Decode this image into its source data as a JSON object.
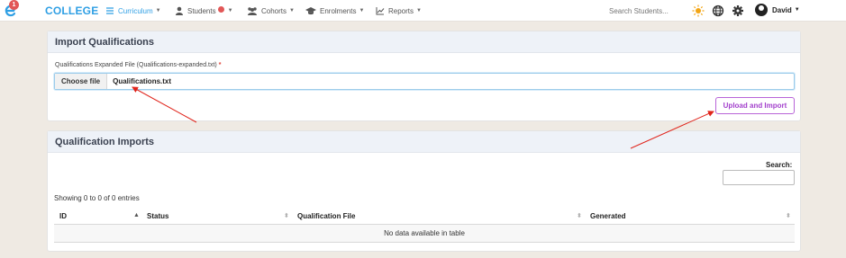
{
  "nav": {
    "logo_badge": "1",
    "brand": "COLLEGE",
    "items": [
      {
        "label": "Curriculum",
        "icon": "menu-lines-icon",
        "active": true
      },
      {
        "label": "Students",
        "icon": "user-icon",
        "has_notification": true
      },
      {
        "label": "Cohorts",
        "icon": "users-icon"
      },
      {
        "label": "Enrolments",
        "icon": "graduation-cap-icon"
      },
      {
        "label": "Reports",
        "icon": "line-chart-icon"
      }
    ],
    "search_placeholder": "Search Students...",
    "user_name": "David"
  },
  "import_panel": {
    "title": "Import Qualifications",
    "field_label": "Qualifications Expanded File (Qualifications-expanded.txt)",
    "required_mark": "*",
    "choose_file_label": "Choose file",
    "file_name": "Qualifications.txt",
    "upload_button": "Upload and Import"
  },
  "imports_panel": {
    "title": "Qualification Imports",
    "search_label": "Search:",
    "search_value": "",
    "entries_info": "Showing 0 to 0 of 0 entries",
    "columns": [
      "ID",
      "Status",
      "Qualification File",
      "Generated"
    ],
    "empty_message": "No data available in table"
  },
  "colors": {
    "brand": "#2f9fe4",
    "accent_purple": "#a23fcc",
    "annotation_arrow": "#e0241b",
    "background": "#efeae3"
  }
}
